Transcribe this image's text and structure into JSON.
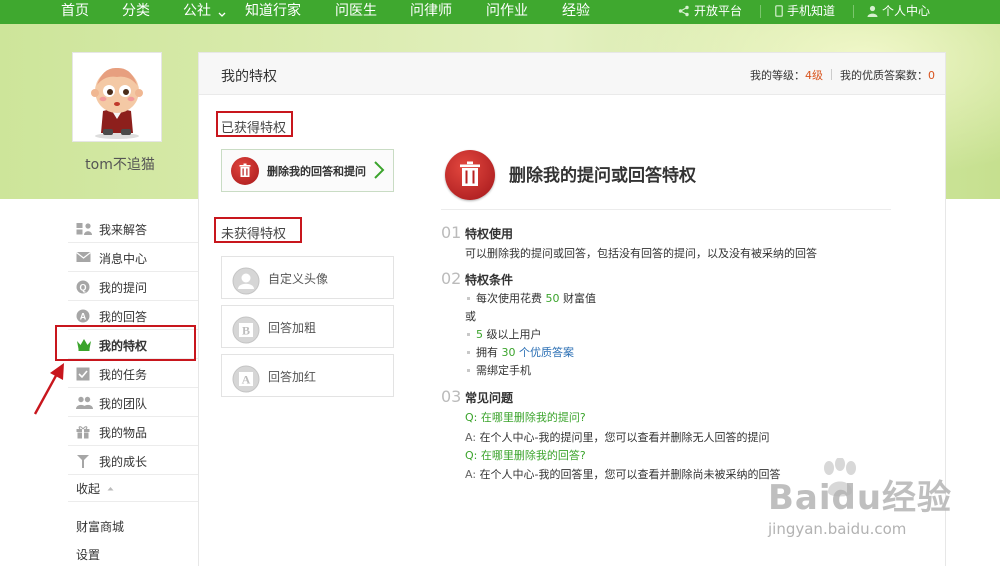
{
  "topnav": {
    "items": [
      "首页",
      "分类",
      "公社",
      "知道行家",
      "问医生",
      "问律师",
      "问作业",
      "经验"
    ],
    "right": [
      "开放平台",
      "手机知道",
      "个人中心"
    ]
  },
  "user": {
    "name": "tom不追猫"
  },
  "sidebar": {
    "items": [
      {
        "label": "我来解答",
        "icon": "answer-icon"
      },
      {
        "label": "消息中心",
        "icon": "mail-icon"
      },
      {
        "label": "我的提问",
        "icon": "question-icon"
      },
      {
        "label": "我的回答",
        "icon": "answer-circle-icon"
      },
      {
        "label": "我的特权",
        "icon": "crown-icon"
      },
      {
        "label": "我的任务",
        "icon": "checkbox-icon"
      },
      {
        "label": "我的团队",
        "icon": "team-icon"
      },
      {
        "label": "我的物品",
        "icon": "gift-icon"
      },
      {
        "label": "我的成长",
        "icon": "growth-icon"
      }
    ],
    "collapse": "收起",
    "shop": "财富商城",
    "settings": "设置"
  },
  "panel": {
    "title": "我的特权",
    "level_label": "我的等级：",
    "level_value": "4级",
    "quality_label": "我的优质答案数：",
    "quality_value": "0",
    "obtained_label": "已获得特权",
    "obtained_card": "删除我的回答和提问",
    "unobtained_label": "未获得特权",
    "unobtained": [
      {
        "label": "自定义头像",
        "icon": "avatar-icon"
      },
      {
        "label": "回答加粗",
        "icon": "bold-icon"
      },
      {
        "label": "回答加红",
        "icon": "red-text-icon"
      }
    ]
  },
  "detail": {
    "title": "删除我的提问或回答特权",
    "s1": {
      "num": "01",
      "heading": "特权使用",
      "text": "可以删除我的提问或回答，包括没有回答的提问，以及没有被采纳的回答"
    },
    "s2": {
      "num": "02",
      "heading": "特权条件",
      "b1_pre": "每次使用花费 ",
      "b1_num": "50",
      "b1_post": " 财富值",
      "or": "或",
      "b2_num": "5",
      "b2_post": " 级以上用户",
      "b3_pre": "拥有 ",
      "b3_num": "30",
      "b3_post": " 个优质答案",
      "b4": "需绑定手机"
    },
    "s3": {
      "num": "03",
      "heading": "常见问题",
      "q1": "Q: 在哪里删除我的提问?",
      "a1_label": "A:",
      "a1": "在个人中心-我的提问里，您可以查看并删除无人回答的提问",
      "q2": "Q: 在哪里删除我的回答?",
      "a2_label": "A:",
      "a2": "在个人中心-我的回答里，您可以查看并删除尚未被采纳的回答"
    }
  },
  "watermark": {
    "brand": "Baidu经验",
    "url": "jingyan.baidu.com"
  },
  "colors": {
    "nav_green": "#3fa82f",
    "annotation_red": "#c8161d",
    "accent_orange": "#d9541e"
  }
}
